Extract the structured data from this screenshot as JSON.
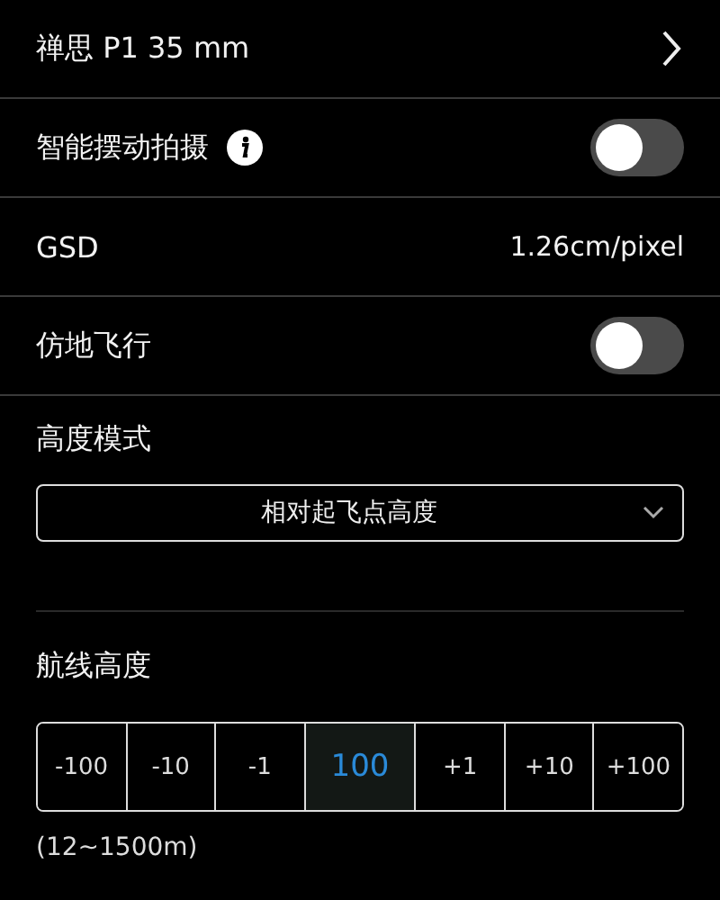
{
  "camera": {
    "label": "禅思 P1 35 mm"
  },
  "settings": [
    {
      "kind": "toggle",
      "label": "智能摆动拍摄",
      "info": true,
      "on": false
    },
    {
      "kind": "value",
      "label": "GSD",
      "value": "1.26cm/pixel"
    },
    {
      "kind": "toggle",
      "label": "仿地飞行",
      "info": false,
      "on": false
    }
  ],
  "altitude_mode": {
    "label": "高度模式",
    "value": "相对起飞点高度"
  },
  "route_altitude": {
    "label": "航线高度",
    "steps": [
      {
        "kind": "step",
        "label": "-100"
      },
      {
        "kind": "step",
        "label": "-10"
      },
      {
        "kind": "step",
        "label": "-1"
      },
      {
        "kind": "value",
        "label": "100"
      },
      {
        "kind": "step",
        "label": "+1"
      },
      {
        "kind": "step",
        "label": "+10"
      },
      {
        "kind": "step",
        "label": "+100"
      }
    ],
    "range": "(12~1500m)"
  }
}
